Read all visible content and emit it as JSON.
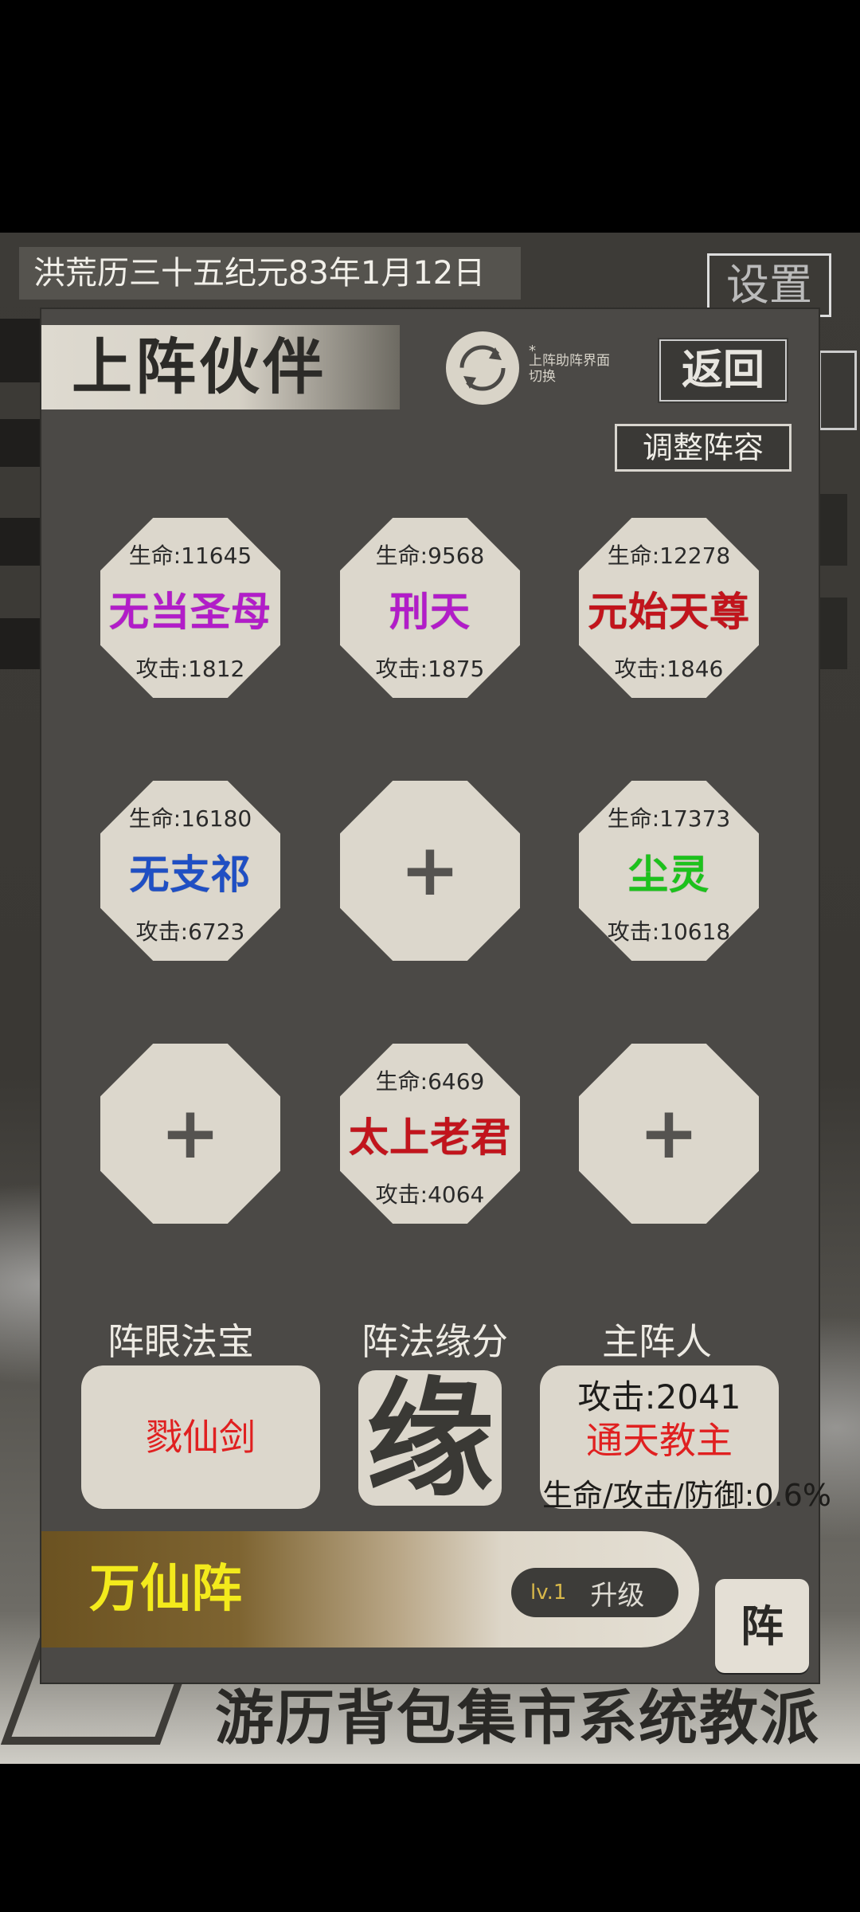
{
  "background": {
    "date": "洪荒历三十五纪元83年1月12日",
    "settings_label": "设置",
    "bottom_nav": "游历背包集市系统教派"
  },
  "panel": {
    "title": "上阵伙伴",
    "switch_hint_star": "*",
    "switch_hint": "上阵助阵界面切换",
    "back_label": "返回",
    "adjust_label": "调整阵容"
  },
  "partners": [
    {
      "hp": "生命:11645",
      "name": "无当圣母",
      "atk": "攻击:1812",
      "color": "#b21cc9"
    },
    {
      "hp": "生命:9568",
      "name": "刑天",
      "atk": "攻击:1875",
      "color": "#b21cc9"
    },
    {
      "hp": "生命:12278",
      "name": "元始天尊",
      "atk": "攻击:1846",
      "color": "#c2141c"
    },
    {
      "hp": "生命:16180",
      "name": "无支祁",
      "atk": "攻击:6723",
      "color": "#1f4fc4"
    },
    {
      "plus": "+"
    },
    {
      "hp": "生命:17373",
      "name": "尘灵",
      "atk": "攻击:10618",
      "color": "#1cc21c"
    },
    {
      "plus": "+"
    },
    {
      "hp": "生命:6469",
      "name": "太上老君",
      "atk": "攻击:4064",
      "color": "#c2141c"
    },
    {
      "plus": "+"
    }
  ],
  "sections": {
    "treasure_label": "阵眼法宝",
    "treasure_name": "戮仙剑",
    "treasure_color": "#e02020",
    "fortune_label": "阵法缘分",
    "fortune_char": "缘",
    "leader_label": "主阵人",
    "leader_attack": "攻击:2041",
    "leader_name": "通天教主",
    "leader_color": "#e02020",
    "bonus": "生命/攻击/防御:0.6%"
  },
  "formation": {
    "name": "万仙阵",
    "level": "lv.1",
    "upgrade_label": "升级",
    "button_label": "阵"
  }
}
